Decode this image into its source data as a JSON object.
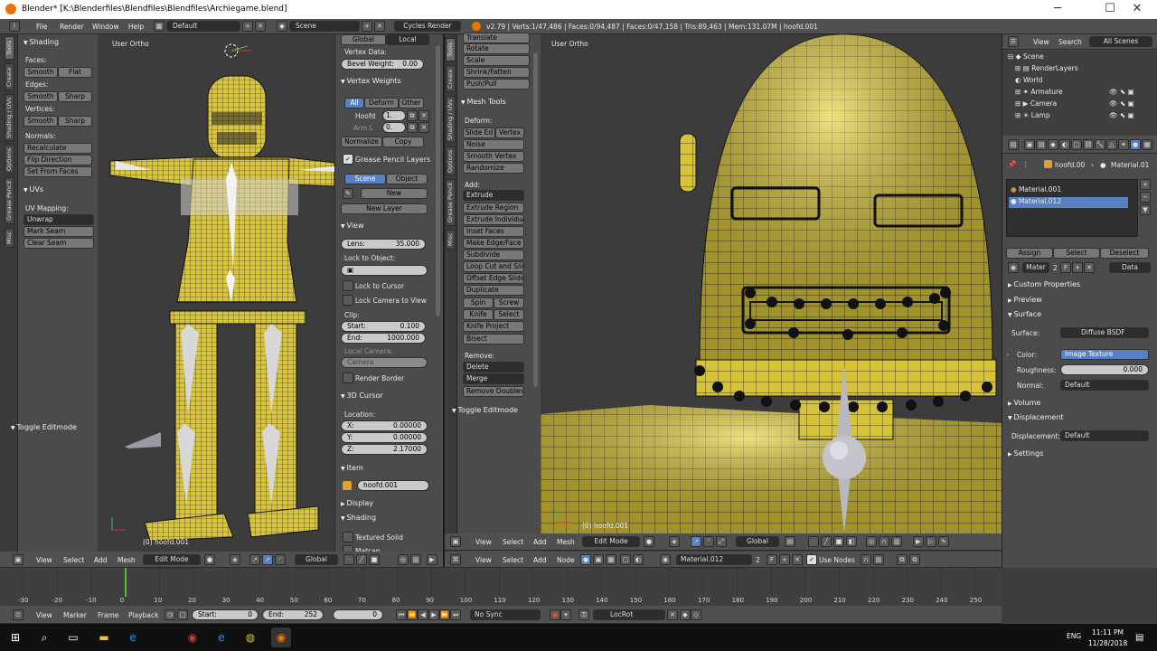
{
  "window": {
    "title": "Blender* [K:\\Blenderfiles\\Blendfiles\\Blendfiles\\Archiegame.blend]",
    "min": "─",
    "max": "☐",
    "close": "✕"
  },
  "infobar": {
    "menus": [
      "File",
      "Render",
      "Window",
      "Help"
    ],
    "layout": "Default",
    "scene": "Scene",
    "engine": "Cycles Render",
    "stats": "v2.79 | Verts:1/47,486 | Faces:0/94,487 | Faces:0/47,158 | Tris:89,463 | Mem:131.07M | hoofd.001"
  },
  "left_tools": {
    "tabs": [
      "Tools",
      "Create",
      "Shading / UVs",
      "Options",
      "Grease Pencil",
      "Misc"
    ],
    "shading": {
      "header": "Shading",
      "faces": "Faces:",
      "smooth": "Smooth",
      "flat": "Flat",
      "edges": "Edges:",
      "smooth2": "Smooth",
      "sharp": "Sharp",
      "vertices": "Vertices:",
      "smooth3": "Smooth",
      "sharp2": "Sharp",
      "normals": "Normals:",
      "recalculate": "Recalculate",
      "flip": "Flip Direction",
      "set_from_faces": "Set From Faces"
    },
    "uvs": {
      "header": "UVs",
      "mapping": "UV Mapping:",
      "unwrap": "Unwrap",
      "mark_seam": "Mark Seam",
      "clear_seam": "Clear Seam"
    },
    "toggle": "Toggle Editmode"
  },
  "vp_left": {
    "label": "User Ortho",
    "object": "(0) hoofd.001"
  },
  "props_n": {
    "global": "Global",
    "local": "Local",
    "vertex_data": "Vertex Data:",
    "bevel_weight": "Bevel Weight:",
    "bevel_value": "0.00",
    "vgroups": {
      "header": "Vertex Weights",
      "all": "All",
      "deform": "Deform",
      "other": "Other",
      "g1": "Hoofd",
      "g1v": "1.",
      "g2": "Arm.L",
      "g2v": "0.",
      "normalize": "Normalize",
      "copy": "Copy"
    },
    "gp": {
      "header": "Grease Pencil Layers",
      "scene": "Scene",
      "object": "Object",
      "new": "New",
      "new_layer": "New Layer"
    },
    "view": {
      "header": "View",
      "lens_label": "Lens:",
      "lens": "35.000",
      "lock_obj": "Lock to Object:",
      "lock_cursor": "Lock to Cursor",
      "lock_cam": "Lock Camera to View",
      "clip": "Clip:",
      "start_label": "Start:",
      "start": "0.100",
      "end_label": "End:",
      "end": "1000.000",
      "local_cam": "Local Camera:",
      "camera": "Camera",
      "render_border": "Render Border"
    },
    "cursor": {
      "header": "3D Cursor",
      "location": "Location:",
      "x_label": "X:",
      "x": "0.00000",
      "y_label": "Y:",
      "y": "0.00000",
      "z_label": "Z:",
      "z": "2.17000"
    },
    "item": {
      "header": "Item",
      "name": "hoofd.001"
    },
    "display": "Display",
    "shading": "Shading",
    "textured_solid": "Textured Solid",
    "matcap": "Matcap"
  },
  "mid_tools": {
    "tabs": [
      "Tools",
      "Create",
      "Shading / UVs",
      "Options",
      "Grease Pencil",
      "Misc"
    ],
    "top": [
      "Translate",
      "Rotate",
      "Scale",
      "Shrink/Fatten",
      "Push/Pull"
    ],
    "mesh_tools": "Mesh Tools",
    "deform": "Deform:",
    "slide_edge": "Slide Ed",
    "vertex": "Vertex",
    "noise": "Noise",
    "smooth_vertex": "Smooth Vertex",
    "randomize": "Randomize",
    "add": "Add:",
    "extrude": "Extrude",
    "add_items": [
      "Extrude Region",
      "Extrude Individual",
      "Inset Faces",
      "Make Edge/Face",
      "Subdivide",
      "Loop Cut and Slide",
      "Offset Edge Slide",
      "Duplicate"
    ],
    "spin": "Spin",
    "screw": "Screw",
    "knife": "Knife",
    "select": "Select",
    "knife_project": "Knife Project",
    "bisect": "Bisect",
    "remove": "Remove:",
    "delete": "Delete",
    "merge": "Merge",
    "remove_doubles": "Remove Doubles",
    "toggle": "Toggle Editmode"
  },
  "vp_right": {
    "label": "User Ortho",
    "object": "(0) hoofd.001"
  },
  "vp_left_header": {
    "menus": [
      "View",
      "Select",
      "Add",
      "Mesh"
    ],
    "mode": "Edit Mode",
    "orient": "Global"
  },
  "vp_right_header": {
    "menus": [
      "View",
      "Select",
      "Add",
      "Mesh"
    ],
    "mode": "Edit Mode",
    "orient": "Global"
  },
  "node_header": {
    "menus": [
      "View",
      "Select",
      "Add",
      "Node"
    ],
    "material": "Material.012",
    "users": "2",
    "f": "F",
    "use_nodes": "Use Nodes"
  },
  "outliner": {
    "menus": [
      "View",
      "Search"
    ],
    "filter": "All Scenes",
    "items": [
      {
        "name": "Scene",
        "indent": 0
      },
      {
        "name": "RenderLayers",
        "indent": 1
      },
      {
        "name": "World",
        "indent": 1
      },
      {
        "name": "Armature",
        "indent": 1
      },
      {
        "name": "Camera",
        "indent": 1
      },
      {
        "name": "Lamp",
        "indent": 1
      }
    ]
  },
  "properties": {
    "breadcrumb_obj": "hoofd.00",
    "breadcrumb_mat": "Material.01",
    "slots": [
      "Material.001",
      "Material.012"
    ],
    "assign": "Assign",
    "select": "Select",
    "deselect": "Deselect",
    "mat_name": "Mater",
    "mat_users": "2",
    "mat_f": "F",
    "data": "Data",
    "custom": "Custom Properties",
    "preview": "Preview",
    "surface": "Surface",
    "surface_label": "Surface:",
    "surface_value": "Diffuse BSDF",
    "color_label": "Color:",
    "color_value": "Image Texture",
    "rough_label": "Roughness:",
    "rough_value": "0.000",
    "normal_label": "Normal:",
    "normal_value": "Default",
    "volume": "Volume",
    "displacement": "Displacement",
    "disp_label": "Displacement:",
    "disp_value": "Default",
    "settings": "Settings"
  },
  "timeline": {
    "ticks": [
      "-30",
      "-20",
      "-10",
      "0",
      "10",
      "20",
      "30",
      "40",
      "50",
      "60",
      "70",
      "80",
      "90",
      "100",
      "110",
      "120",
      "130",
      "140",
      "150",
      "160",
      "170",
      "180",
      "190",
      "200",
      "210",
      "220",
      "230",
      "240",
      "250"
    ],
    "menus": [
      "View",
      "Marker",
      "Frame",
      "Playback"
    ],
    "start_label": "Start:",
    "start": "0",
    "end_label": "End:",
    "end": "252",
    "current": "0",
    "sync": "No Sync",
    "keying": "LocRot"
  },
  "taskbar": {
    "time": "11:11 PM",
    "date": "11/28/2018",
    "lang": "ENG"
  },
  "colors": {
    "mesh": "#d9c43a",
    "accent": "#5680c2"
  }
}
